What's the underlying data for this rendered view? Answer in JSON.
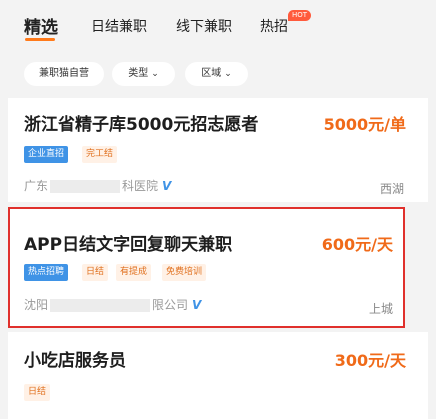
{
  "tabs": [
    {
      "label": "精选"
    },
    {
      "label": "日结兼职"
    },
    {
      "label": "线下兼职"
    },
    {
      "label": "热招"
    }
  ],
  "hot_badge": "HOT",
  "filters": [
    {
      "label": "兼职猫自营"
    },
    {
      "label": "类型"
    },
    {
      "label": "区域"
    }
  ],
  "jobs": [
    {
      "title": "浙江省精子库5000元招志愿者",
      "pay": "5000元/单",
      "tags": [
        "企业直招",
        "完工结"
      ],
      "company_prefix": "广东",
      "company_suffix": "科医院",
      "location": "西湖"
    },
    {
      "title": "APP日结文字回复聊天兼职",
      "pay": "600元/天",
      "tags": [
        "热点招聘",
        "日结",
        "有提成",
        "免费培训"
      ],
      "company_prefix": "沈阳",
      "company_suffix": "限公司",
      "location": "上城"
    },
    {
      "title": "小吃店服务员",
      "pay": "300元/天",
      "tags": [
        "日结"
      ]
    }
  ],
  "colors": {
    "accent": "#f06a19",
    "tag_blue": "#3f93e6",
    "highlight_border": "#e0302c"
  }
}
